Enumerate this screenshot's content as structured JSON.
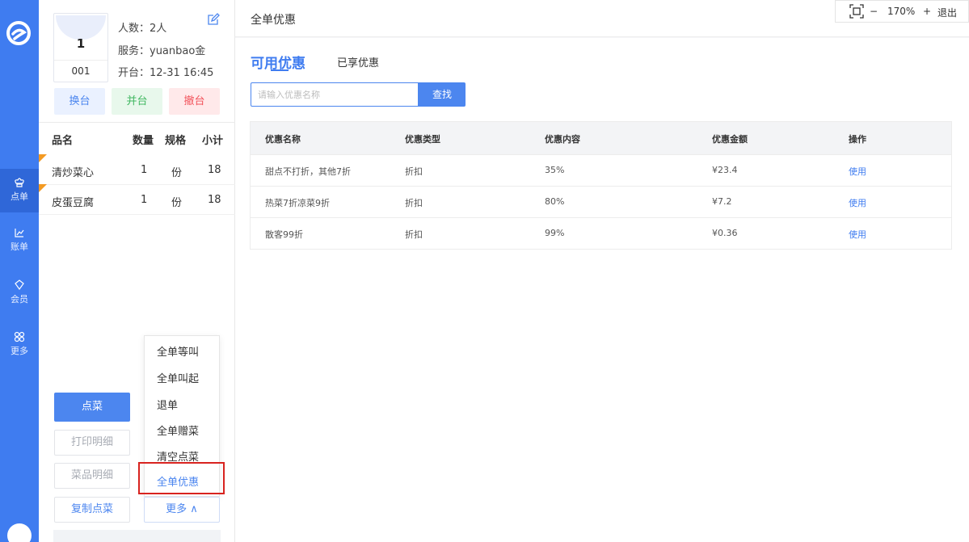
{
  "colors": {
    "primary": "#3f7cf0",
    "green": "#42b862",
    "red": "#f2535b",
    "highlight": "#d8231f"
  },
  "nav": [
    {
      "label": "点单",
      "icon": "chef-hat-icon",
      "active": true
    },
    {
      "label": "账单",
      "icon": "chart-icon",
      "active": false
    },
    {
      "label": "会员",
      "icon": "member-icon",
      "active": false
    },
    {
      "label": "更多",
      "icon": "more-icon",
      "active": false
    }
  ],
  "table_info": {
    "table_number": "1",
    "table_code": "001",
    "guests": "人数：2人",
    "server": "服务：yuanbao金",
    "opened": "开台：12-31 16:45"
  },
  "table_actions": {
    "change": "换台",
    "merge": "并台",
    "cancel": "撤台"
  },
  "order_columns": {
    "name": "品名",
    "qty": "数量",
    "unit": "规格",
    "subtotal": "小计"
  },
  "order_items": [
    {
      "name": "清炒菜心",
      "qty": "1",
      "unit": "份",
      "subtotal": "18"
    },
    {
      "name": "皮蛋豆腐",
      "qty": "1",
      "unit": "份",
      "subtotal": "18"
    }
  ],
  "more_menu": [
    "全单等叫",
    "全单叫起",
    "退单",
    "全单赠菜",
    "清空点菜",
    "全单优惠"
  ],
  "buttons": {
    "order": "点菜",
    "print_detail": "打印明细",
    "dish_detail": "菜品明细",
    "copy_order": "复制点菜",
    "more": "更多 ∧"
  },
  "header": {
    "title": "全单优惠"
  },
  "zoom": {
    "minus": "−",
    "level": "170%",
    "plus": "+",
    "exit": "退出"
  },
  "discount": {
    "tab_available": "可用优惠",
    "tab_used": "已享优惠",
    "search_placeholder": "请输入优惠名称",
    "search_button": "查找",
    "columns": {
      "name": "优惠名称",
      "type": "优惠类型",
      "content": "优惠内容",
      "amount": "优惠金额",
      "action": "操作"
    },
    "rows": [
      {
        "name": "甜点不打折，其他7折",
        "type": "折扣",
        "content": "35%",
        "amount": "¥23.4",
        "action": "使用"
      },
      {
        "name": "热菜7折凉菜9折",
        "type": "折扣",
        "content": "80%",
        "amount": "¥7.2",
        "action": "使用"
      },
      {
        "name": "散客99折",
        "type": "折扣",
        "content": "99%",
        "amount": "¥0.36",
        "action": "使用"
      }
    ]
  }
}
